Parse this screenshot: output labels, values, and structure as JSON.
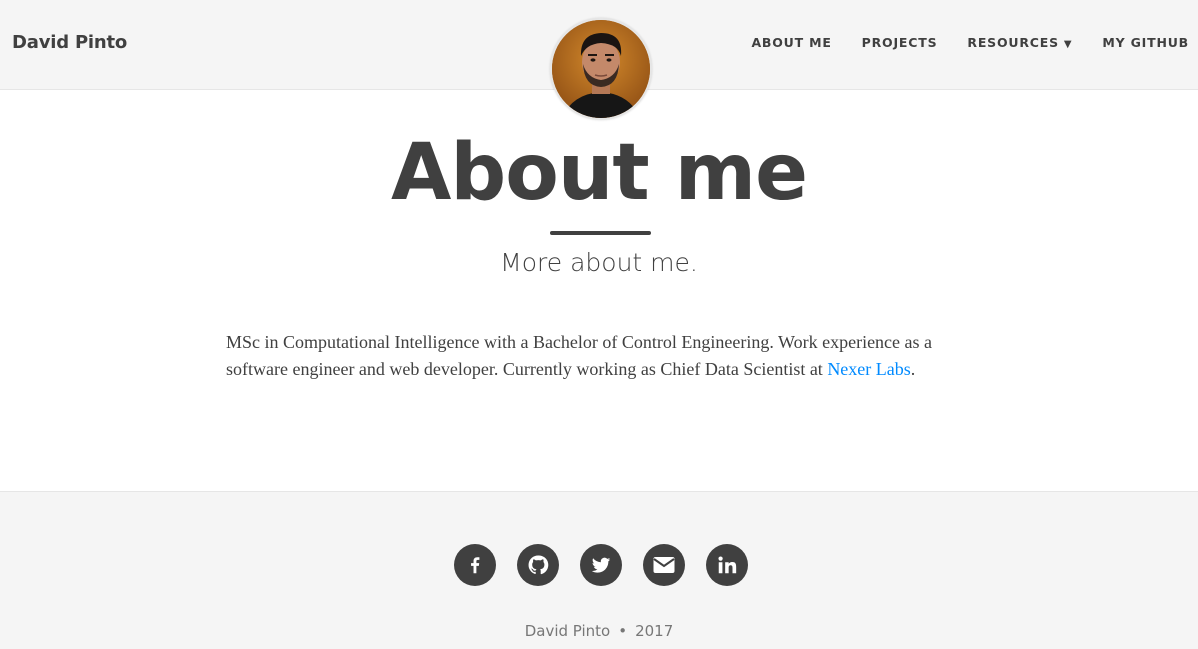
{
  "navbar": {
    "brand": "David Pinto",
    "links": [
      {
        "label": "ABOUT ME"
      },
      {
        "label": "PROJECTS"
      },
      {
        "label": "RESOURCES",
        "caret": "▼"
      },
      {
        "label": "MY GITHUB"
      }
    ]
  },
  "avatar": {
    "icon": "profile-photo"
  },
  "header": {
    "title": "About me",
    "subtitle": "More about me."
  },
  "content": {
    "text_before_link": "MSc in Computational Intelligence with a Bachelor of Control Engineering. Work experience as a software engineer and web developer. Currently working as Chief Data Scientist at ",
    "link_text": "Nexer Labs",
    "text_after_link": "."
  },
  "footer": {
    "social": [
      {
        "icon": "facebook-icon"
      },
      {
        "icon": "github-icon"
      },
      {
        "icon": "twitter-icon"
      },
      {
        "icon": "email-icon"
      },
      {
        "icon": "linkedin-icon"
      }
    ],
    "author": "David Pinto",
    "separator": "•",
    "year": "2017"
  },
  "colors": {
    "text": "#404040",
    "link": "#008AFF",
    "background_alt": "#f5f5f5"
  }
}
